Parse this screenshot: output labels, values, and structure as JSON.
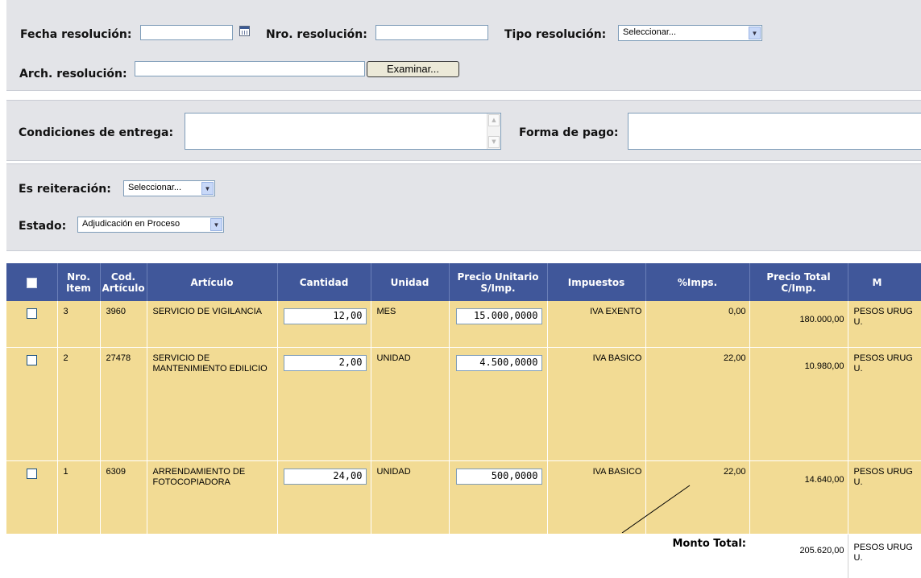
{
  "resolution": {
    "fecha_label": "Fecha resolución:",
    "fecha_value": "",
    "nro_label": "Nro. resolución:",
    "nro_value": "",
    "tipo_label": "Tipo resolución:",
    "tipo_selected": "Seleccionar...",
    "arch_label": "Arch. resolución:",
    "arch_value": "",
    "examinar_label": "Examinar..."
  },
  "delivery": {
    "condiciones_label": "Condiciones de entrega:",
    "condiciones_value": "",
    "forma_pago_label": "Forma de pago:",
    "forma_pago_value": ""
  },
  "status": {
    "reiteracion_label": "Es reiteración:",
    "reiteracion_selected": "Seleccionar...",
    "estado_label": "Estado:",
    "estado_selected": "Adjudicación en Proceso"
  },
  "table": {
    "headers": [
      "Nro. Item",
      "Cod. Artículo",
      "Artículo",
      "Cantidad",
      "Unidad",
      "Precio Unitario S/Imp.",
      "Impuestos",
      "%Imps.",
      "Precio Total C/Imp.",
      "M"
    ],
    "rows": [
      {
        "item": "3",
        "codigo": "3960",
        "articulo": "SERVICIO DE VIGILANCIA",
        "cantidad": "12,00",
        "unidad": "MES",
        "precio_unitario": "15.000,0000",
        "impuesto": "IVA EXENTO",
        "pct_imps": "0,00",
        "precio_total": "180.000,00",
        "moneda": "PESOS URUGU."
      },
      {
        "item": "2",
        "codigo": "27478",
        "articulo": "SERVICIO DE MANTENIMIENTO EDILICIO",
        "cantidad": "2,00",
        "unidad": "UNIDAD",
        "precio_unitario": "4.500,0000",
        "impuesto": "IVA BASICO",
        "pct_imps": "22,00",
        "precio_total": "10.980,00",
        "moneda": "PESOS URUGU."
      },
      {
        "item": "1",
        "codigo": "6309",
        "articulo": "ARRENDAMIENTO DE FOTOCOPIADORA",
        "cantidad": "24,00",
        "unidad": "UNIDAD",
        "precio_unitario": "500,0000",
        "impuesto": "IVA BASICO",
        "pct_imps": "22,00",
        "precio_total": "14.640,00",
        "moneda": "PESOS URUGU."
      }
    ],
    "total_label": "Monto Total:",
    "total_value": "205.620,00",
    "total_moneda": "PESOS URUGU."
  },
  "colors": {
    "header_bg": "#40579a",
    "row_bg": "#f2db94",
    "panel_bg": "#e3e4e8"
  }
}
